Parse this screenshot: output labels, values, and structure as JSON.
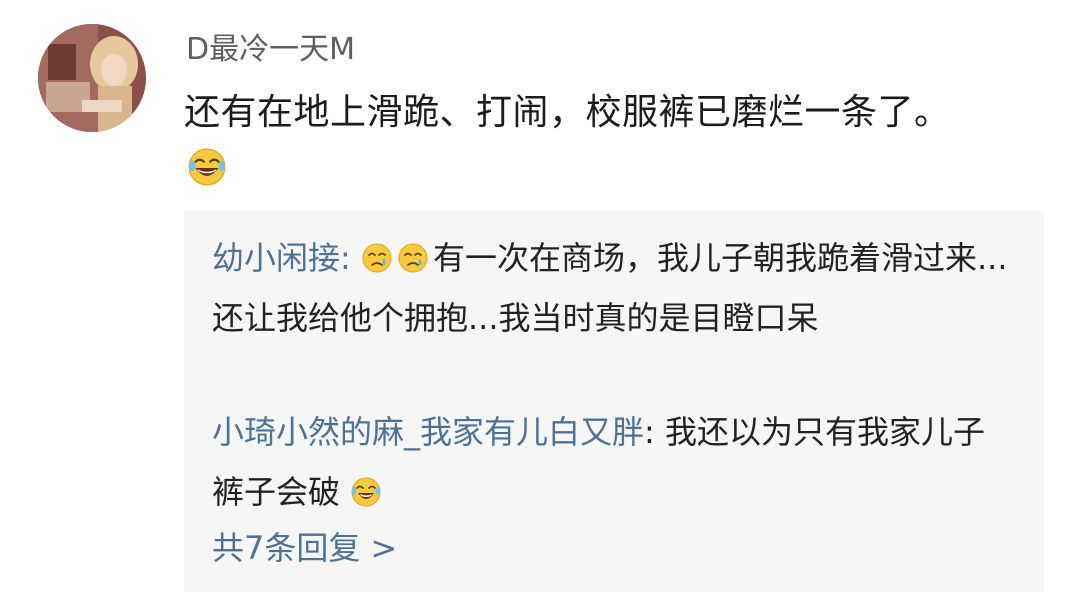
{
  "comment": {
    "username": "D最冷一天M",
    "text": "还有在地上滑跪、打闹，校服裤已磨烂一条了。",
    "emoji_icon": "laughing-crying-emoji"
  },
  "replies": [
    {
      "author": "幼小闲接",
      "separator": ": ",
      "emoji_icons": [
        "sad-tears-emoji",
        "sad-tears-emoji"
      ],
      "text": "有一次在商场，我儿子朝我跪着滑过来...还让我给他个拥抱...我当时真的是目瞪口呆"
    },
    {
      "author": "小琦小然的麻_我家有儿白又胖",
      "separator": ": ",
      "text": "我还以为只有我家儿子裤子会破",
      "emoji_icon": "laughing-crying-emoji"
    }
  ],
  "more_replies": {
    "label": "共7条回复",
    "chevron": ">"
  },
  "colors": {
    "link_blue": "#4d7298",
    "text_dark": "#1c1c1c",
    "username_gray": "#5f5f5f",
    "panel_bg": "#f6f6f7"
  }
}
